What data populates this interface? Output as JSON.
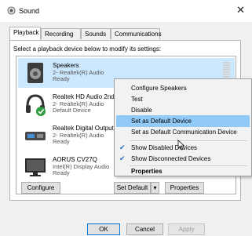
{
  "window": {
    "title": "Sound",
    "close_icon": "close-icon"
  },
  "tabs": [
    "Playback",
    "Recording",
    "Sounds",
    "Communications"
  ],
  "instruction": "Select a playback device below to modify its settings:",
  "devices": [
    {
      "name": "Speakers",
      "line1": "2- Realtek(R) Audio",
      "line2": "Ready",
      "icon": "speaker-icon",
      "selected": true
    },
    {
      "name": "Realtek HD Audio 2nd",
      "line1": "2- Realtek(R) Audio",
      "line2": "Default Device",
      "icon": "headphones-icon",
      "selected": false
    },
    {
      "name": "Realtek Digital Output",
      "line1": "2- Realtek(R) Audio",
      "line2": "Ready",
      "icon": "digital-output-icon",
      "selected": false
    },
    {
      "name": "AORUS CV27Q",
      "line1": "Intel(R) Display Audio",
      "line2": "Ready",
      "icon": "monitor-icon",
      "selected": false
    }
  ],
  "context_menu": {
    "configure": "Configure Speakers",
    "test": "Test",
    "disable": "Disable",
    "set_default": "Set as Default Device",
    "set_default_comm": "Set as Default Communication Device",
    "show_disabled": "Show Disabled Devices",
    "show_disconnected": "Show Disconnected Devices",
    "properties": "Properties"
  },
  "buttons": {
    "configure": "Configure",
    "set_default": "Set Default",
    "properties": "Properties",
    "ok": "OK",
    "cancel": "Cancel",
    "apply": "Apply"
  },
  "colors": {
    "selection": "#cce8ff",
    "menu_highlight": "#91c9f7",
    "check": "#2272c9",
    "default_badge": "#2e9b3e"
  }
}
